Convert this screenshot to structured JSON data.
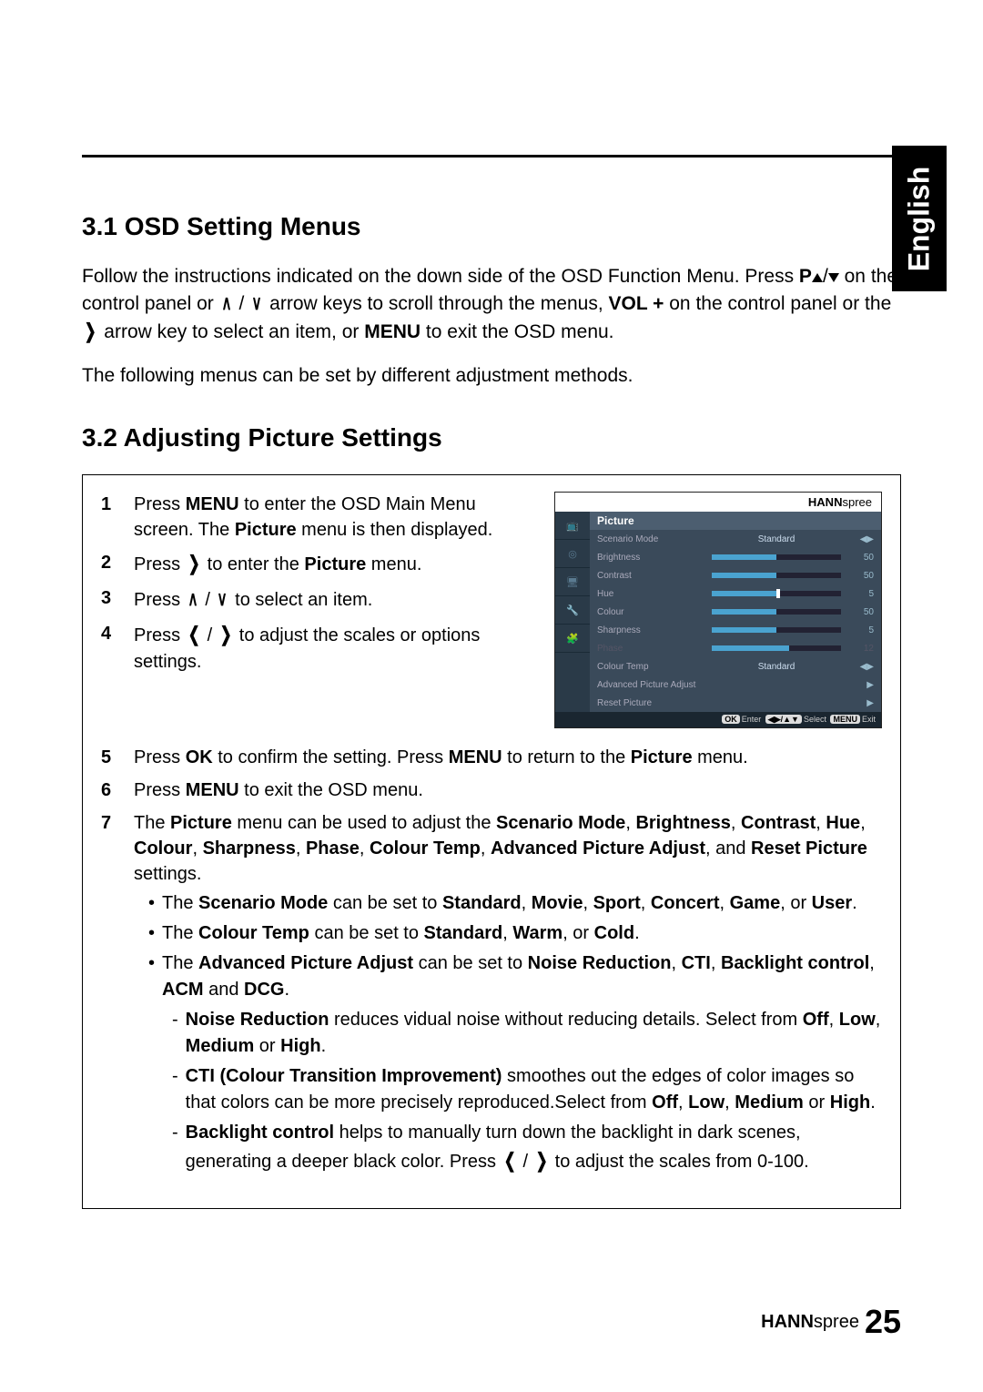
{
  "side_tab": "English",
  "section_31": {
    "heading": "3.1    OSD Setting Menus",
    "para1_a": "Follow the instructions indicated on the down side of the OSD Function Menu. Press ",
    "para1_b": "P",
    "para1_c": "on the control panel or ",
    "para1_d": " arrow keys to scroll through the menus, ",
    "para1_vol": "VOL +",
    "para1_e": " on the control panel or the ",
    "para1_f": " arrow key to select an item, or ",
    "para1_menu": "MENU",
    "para1_g": " to exit the OSD menu.",
    "para2": "The following menus can be set by different adjustment methods."
  },
  "section_32": {
    "heading": "3.2    Adjusting Picture Settings"
  },
  "steps": {
    "s1_a": "Press ",
    "s1_menu": "MENU",
    "s1_b": " to enter the OSD Main Menu screen. The ",
    "s1_pic": "Picture",
    "s1_c": " menu is then displayed.",
    "s2_a": "Press ",
    "s2_b": " to enter the ",
    "s2_pic": "Picture",
    "s2_c": " menu.",
    "s3_a": "Press ",
    "s3_b": " to select an item.",
    "s4_a": "Press ",
    "s4_b": " to adjust the scales or options settings.",
    "s5_a": "Press ",
    "s5_ok": "OK",
    "s5_b": " to confirm the setting. Press ",
    "s5_menu": "MENU",
    "s5_c": " to return to the ",
    "s5_pic": "Picture",
    "s5_d": " menu.",
    "s6_a": "Press ",
    "s6_menu": "MENU",
    "s6_b": " to exit the OSD menu.",
    "s7_a": "The ",
    "s7_pic": "Picture",
    "s7_b": " menu can be used to adjust the ",
    "s7_list1": "Scenario Mode",
    "s7_list2": "Brightness",
    "s7_list3": "Contrast",
    "s7_list4": "Hue",
    "s7_list5": "Colour",
    "s7_list6": "Sharpness",
    "s7_list7": "Phase",
    "s7_list8": "Colour Temp",
    "s7_list9": "Advanced Picture Adjust",
    "s7_list10": "Reset Picture",
    "s7_c": " settings."
  },
  "bullets": {
    "b1_a": "The ",
    "b1_b": "Scenario Mode",
    "b1_c": " can be set to ",
    "b1_opts": [
      "Standard",
      "Movie",
      "Sport",
      "Concert",
      "Game",
      "User"
    ],
    "b2_a": "The ",
    "b2_b": "Colour Temp",
    "b2_c": " can be set to ",
    "b2_opts": [
      "Standard",
      "Warm",
      "Cold"
    ],
    "b3_a": "The ",
    "b3_b": "Advanced Picture Adjust",
    "b3_c": " can be set to ",
    "b3_opts": [
      "Noise Reduction",
      "CTI",
      "Backlight control",
      "ACM",
      "DCG"
    ]
  },
  "dashes": {
    "d1_b": "Noise Reduction",
    "d1_t": " reduces vidual noise without reducing details. Select from ",
    "d1_opts": [
      "Off",
      "Low",
      "Medium",
      "High"
    ],
    "d2_b": "CTI (Colour Transition Improvement)",
    "d2_t": " smoothes out the edges of color images so that colors can be more precisely reproduced.Select from ",
    "d2_opts": [
      "Off",
      "Low",
      "Medium",
      "High"
    ],
    "d3_b": "Backlight control",
    "d3_t1": " helps to manually turn down the backlight in dark scenes, generating a deeper black color. Press ",
    "d3_t2": " to adjust the scales from 0-100."
  },
  "osd": {
    "brand": "HANNspree",
    "title": "Picture",
    "rows": [
      {
        "label": "Scenario Mode",
        "type": "text",
        "value": "Standard",
        "nav": "◀▶"
      },
      {
        "label": "Brightness",
        "type": "bar",
        "fill": 50,
        "value": "50"
      },
      {
        "label": "Contrast",
        "type": "bar",
        "fill": 50,
        "value": "50"
      },
      {
        "label": "Hue",
        "type": "bar",
        "fill": 50,
        "value": "5",
        "marker": true
      },
      {
        "label": "Colour",
        "type": "bar",
        "fill": 50,
        "value": "50"
      },
      {
        "label": "Sharpness",
        "type": "bar",
        "fill": 50,
        "value": "5"
      },
      {
        "label": "Phase",
        "type": "bar",
        "fill": 60,
        "value": "12",
        "dim": true
      },
      {
        "label": "Colour Temp",
        "type": "text",
        "value": "Standard",
        "nav": "◀▶"
      },
      {
        "label": "Advanced Picture Adjust",
        "type": "arrow",
        "value": "▶"
      },
      {
        "label": "Reset Picture",
        "type": "arrow",
        "value": "▶"
      }
    ],
    "footer": {
      "ok": "OK",
      "enter": "Enter",
      "sel_icon": "◀▶/▲▼",
      "select": "Select",
      "menu": "MENU",
      "exit": "Exit"
    }
  },
  "footer": {
    "brand_a": "HANN",
    "brand_b": "spree",
    "page": "25"
  }
}
